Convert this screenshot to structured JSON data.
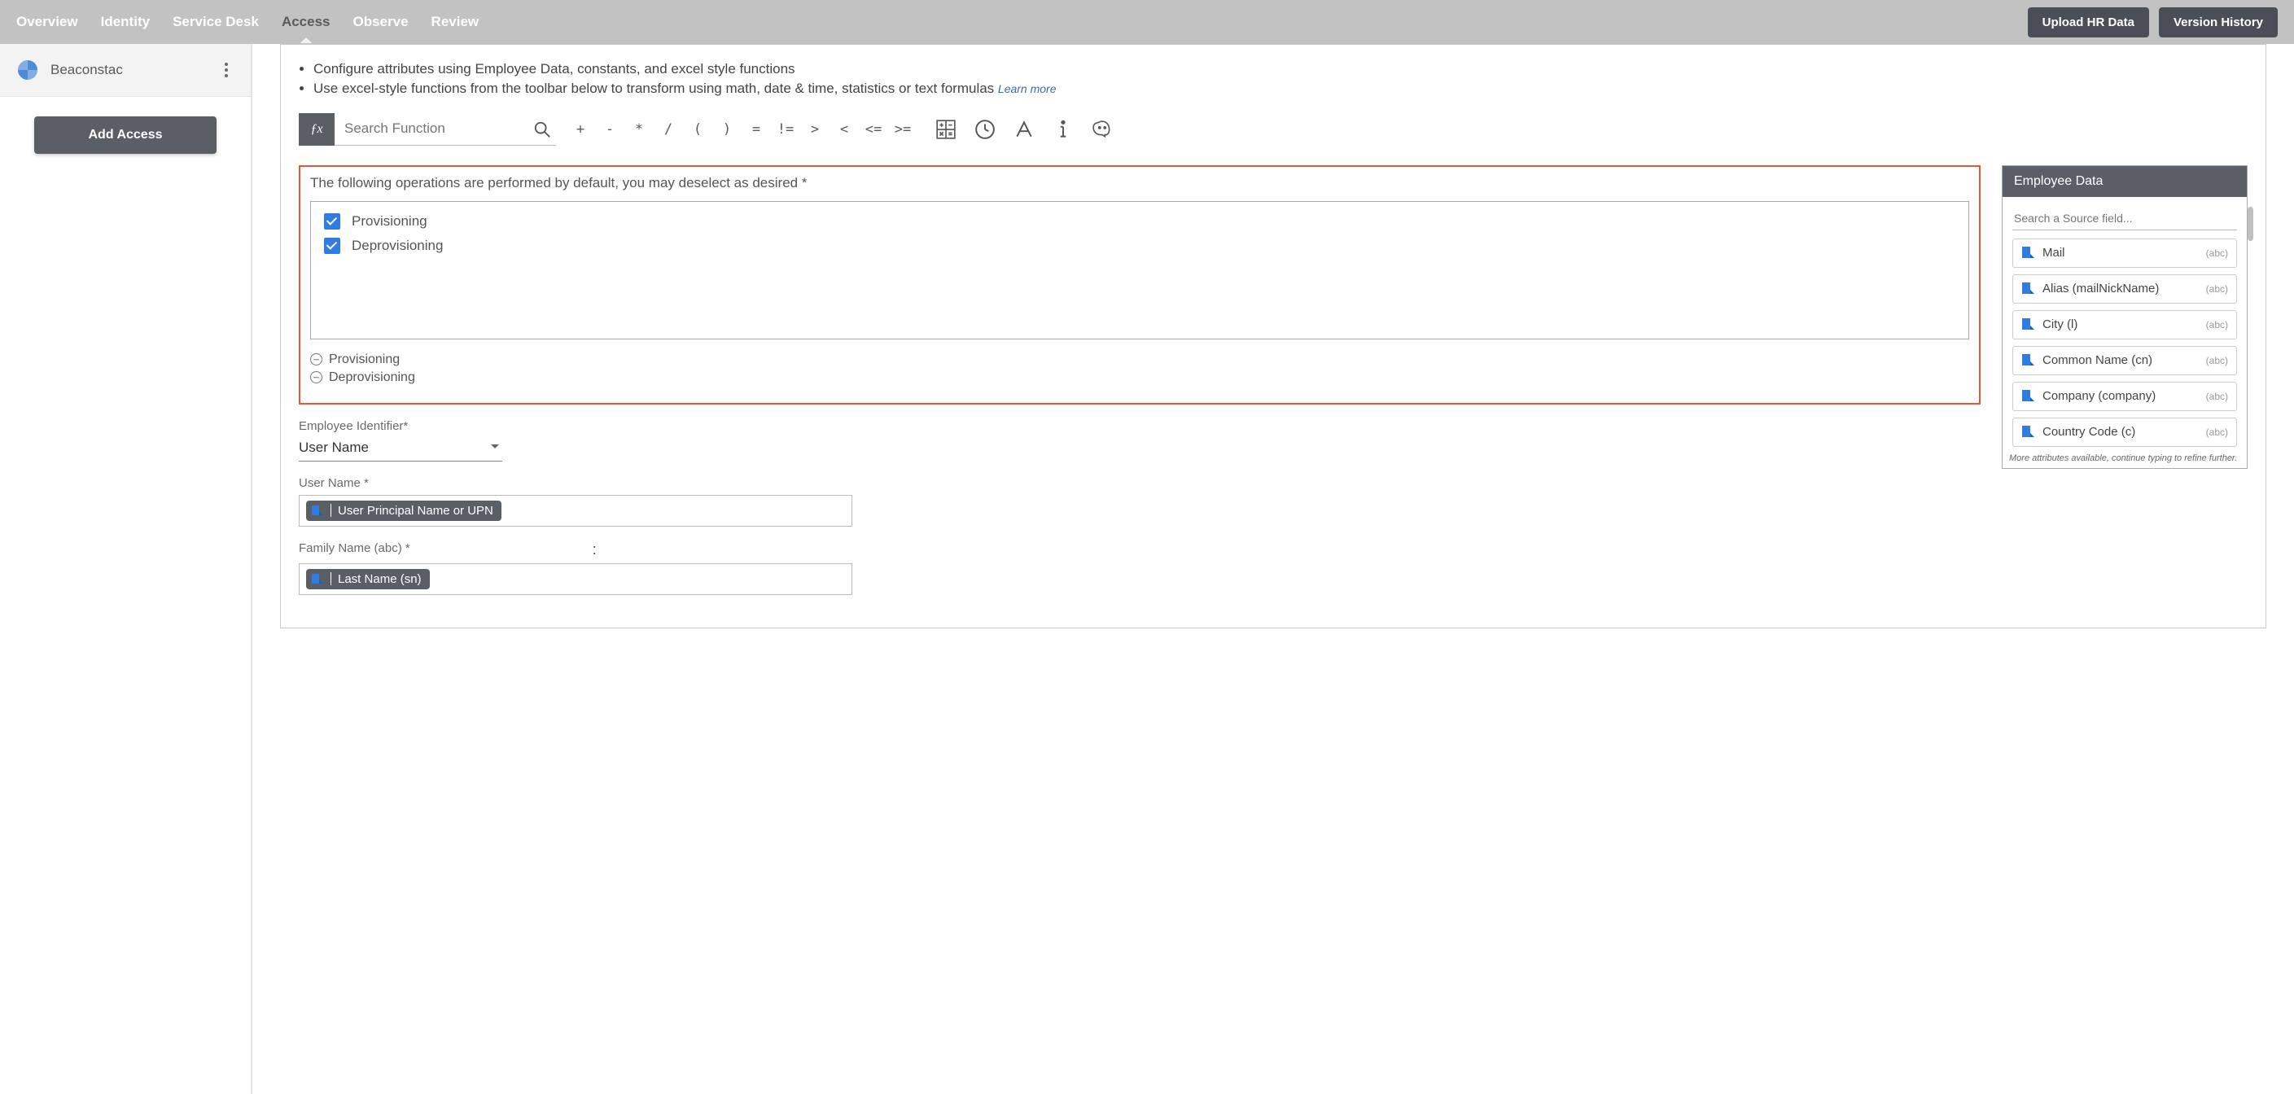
{
  "nav": {
    "tabs": [
      "Overview",
      "Identity",
      "Service Desk",
      "Access",
      "Observe",
      "Review"
    ],
    "active": "Access",
    "actions": {
      "upload": "Upload HR Data",
      "history": "Version History"
    }
  },
  "sidebar": {
    "app_name": "Beaconstac",
    "add_access": "Add Access"
  },
  "instructions": {
    "line1": "Configure attributes using Employee Data, constants, and excel style functions",
    "line2": "Use excel-style functions from the toolbar below to transform using math, date & time, statistics or text formulas",
    "learn_more": "Learn more"
  },
  "toolbar": {
    "search_placeholder": "Search Function",
    "operators": [
      "+",
      "-",
      "*",
      "/",
      "(",
      ")",
      "=",
      "!=",
      ">",
      "<",
      "<=",
      ">="
    ]
  },
  "operations": {
    "label": "The following operations are performed by default, you may deselect as desired *",
    "items": [
      {
        "name": "Provisioning",
        "checked": true
      },
      {
        "name": "Deprovisioning",
        "checked": true
      }
    ],
    "removable": [
      "Provisioning",
      "Deprovisioning"
    ]
  },
  "fields": {
    "employee_identifier": {
      "label": "Employee Identifier*",
      "value": "User Name"
    },
    "user_name": {
      "label": "User Name *",
      "chip": "User Principal Name or UPN"
    },
    "family_name": {
      "label": "Family Name (abc) *",
      "chip": "Last Name (sn)"
    }
  },
  "employee_data": {
    "title": "Employee Data",
    "search_placeholder": "Search a Source field...",
    "items": [
      {
        "name": "Mail",
        "type": "(abc)"
      },
      {
        "name": "Alias (mailNickName)",
        "type": "(abc)"
      },
      {
        "name": "City (l)",
        "type": "(abc)"
      },
      {
        "name": "Common Name (cn)",
        "type": "(abc)"
      },
      {
        "name": "Company (company)",
        "type": "(abc)"
      },
      {
        "name": "Country Code (c)",
        "type": "(abc)"
      }
    ],
    "more_note": "More attributes available, continue typing to refine further."
  }
}
